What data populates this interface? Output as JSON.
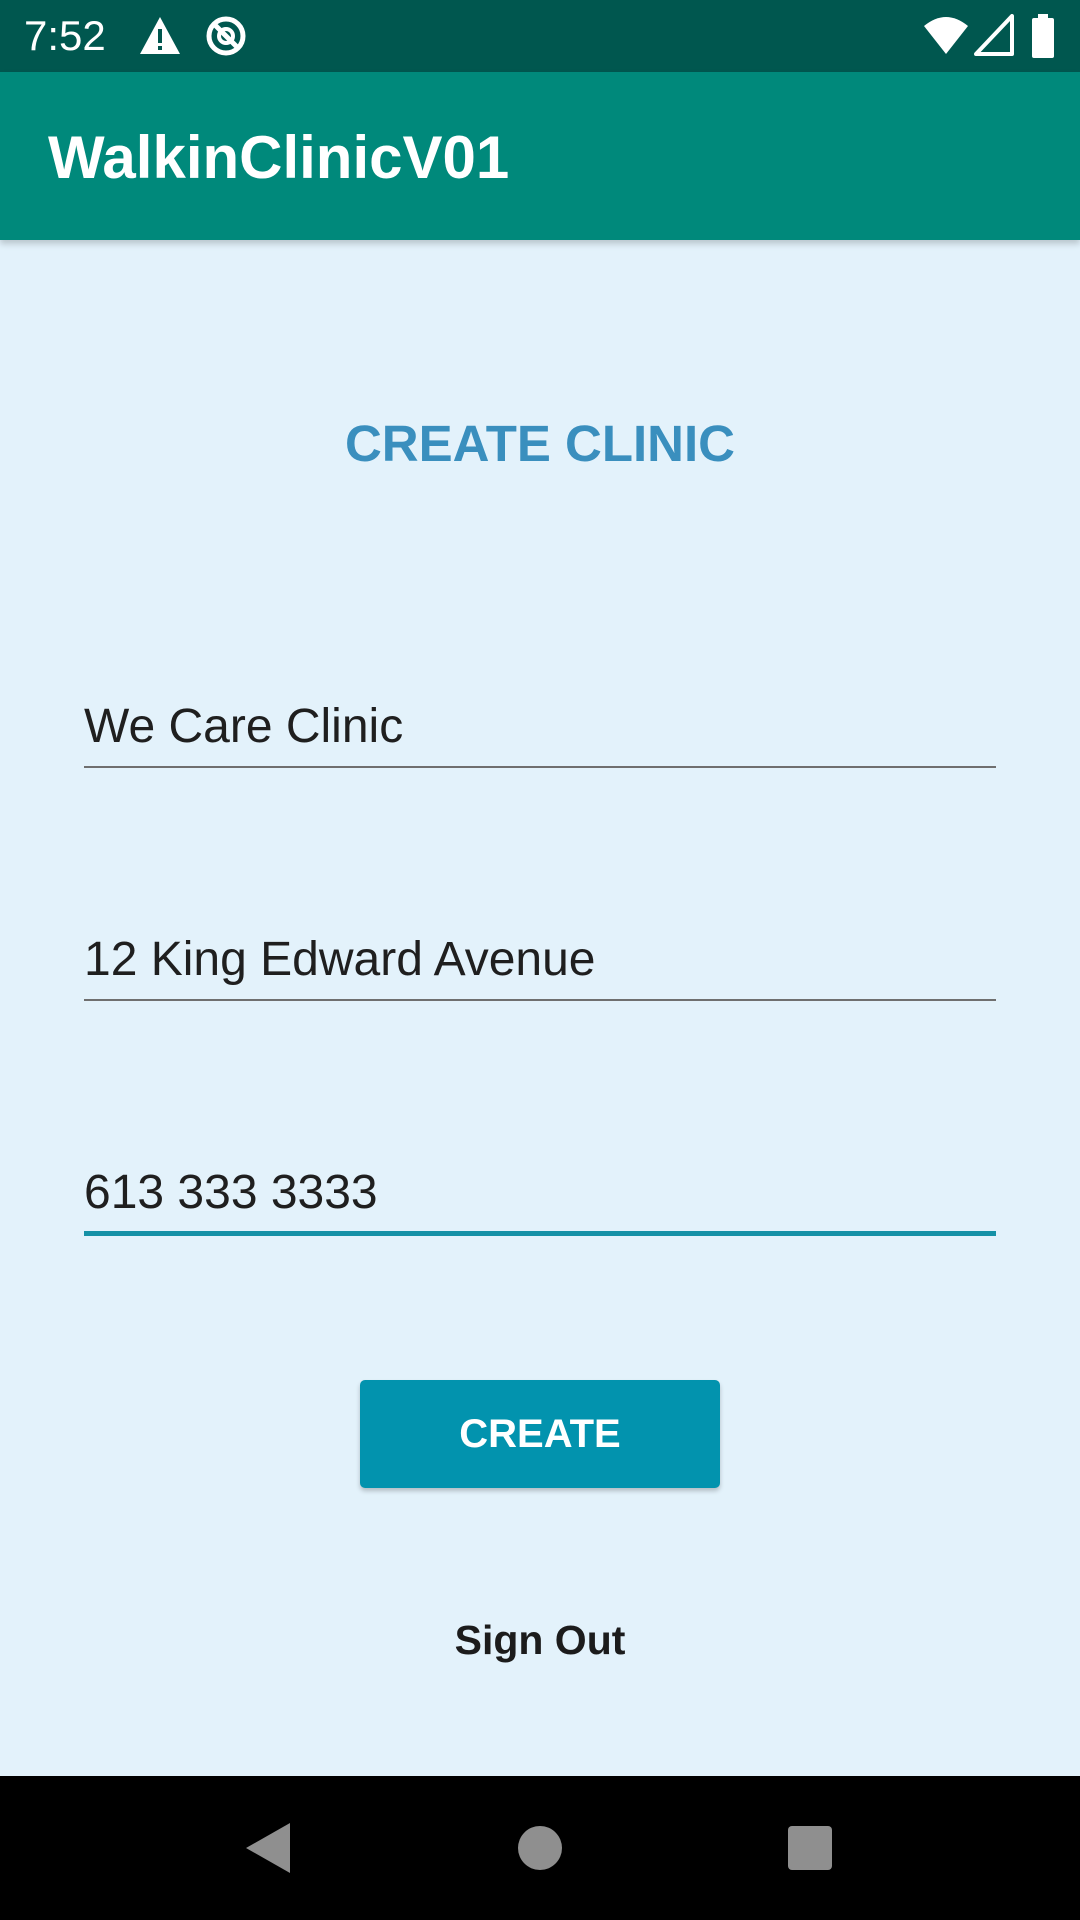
{
  "status_bar": {
    "time": "7:52",
    "icons": [
      "alert-icon",
      "do-not-disturb-icon",
      "wifi-icon",
      "cell-signal-icon",
      "battery-icon"
    ]
  },
  "app_bar": {
    "title": "WalkinClinicV01"
  },
  "form": {
    "heading": "CREATE CLINIC",
    "fields": [
      {
        "name": "clinic-name",
        "value": "We Care Clinic"
      },
      {
        "name": "address",
        "value": "12 King Edward Avenue"
      },
      {
        "name": "phone",
        "value": "613 333 3333"
      }
    ],
    "create_label": "CREATE",
    "signout_label": "Sign Out"
  },
  "nav_bar": {
    "icons": [
      "back-icon",
      "home-icon",
      "recents-icon"
    ]
  },
  "colors": {
    "status_bar": "#00574f",
    "app_bar": "#00897b",
    "background": "#e3f2fb",
    "heading": "#3a8fbe",
    "button": "#0293ae",
    "active_underline": "#1591a6"
  }
}
